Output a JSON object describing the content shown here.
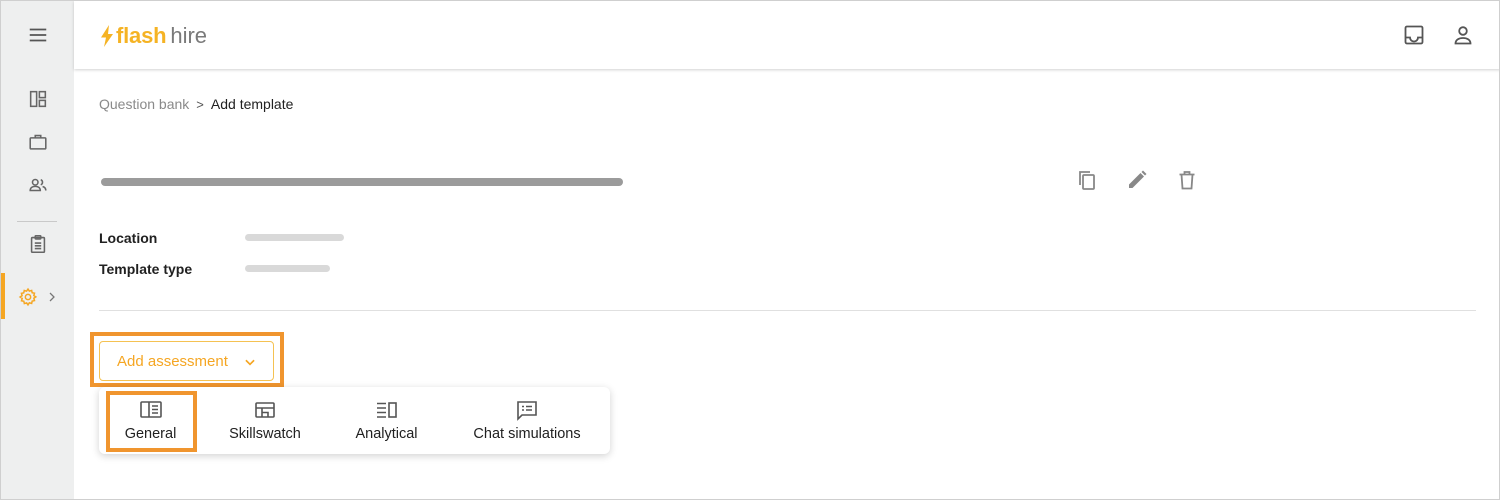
{
  "app": {
    "logo_flash": "flash",
    "logo_hire": "hire"
  },
  "sidebar": {
    "items": [
      {
        "icon": "menu-icon"
      },
      {
        "icon": "dashboard-icon"
      },
      {
        "icon": "briefcase-icon"
      },
      {
        "icon": "people-icon"
      },
      {
        "icon": "clipboard-icon"
      },
      {
        "icon": "settings-icon",
        "active": true
      }
    ]
  },
  "header": {
    "icons": [
      "inbox-icon",
      "user-icon"
    ]
  },
  "breadcrumb": {
    "parent": "Question bank",
    "separator": ">",
    "current": "Add template"
  },
  "template": {
    "actions": [
      "copy-icon",
      "edit-icon",
      "delete-icon"
    ],
    "location_label": "Location",
    "type_label": "Template type"
  },
  "add_assessment": {
    "label": "Add assessment",
    "menu": [
      {
        "label": "General",
        "icon": "general-icon"
      },
      {
        "label": "Skillswatch",
        "icon": "skillswatch-icon"
      },
      {
        "label": "Analytical",
        "icon": "analytical-icon"
      },
      {
        "label": "Chat simulations",
        "icon": "chat-icon"
      }
    ]
  },
  "colors": {
    "accent": "#f5a623",
    "highlight": "#f0952e",
    "sidebar_bg": "#eeefef"
  }
}
